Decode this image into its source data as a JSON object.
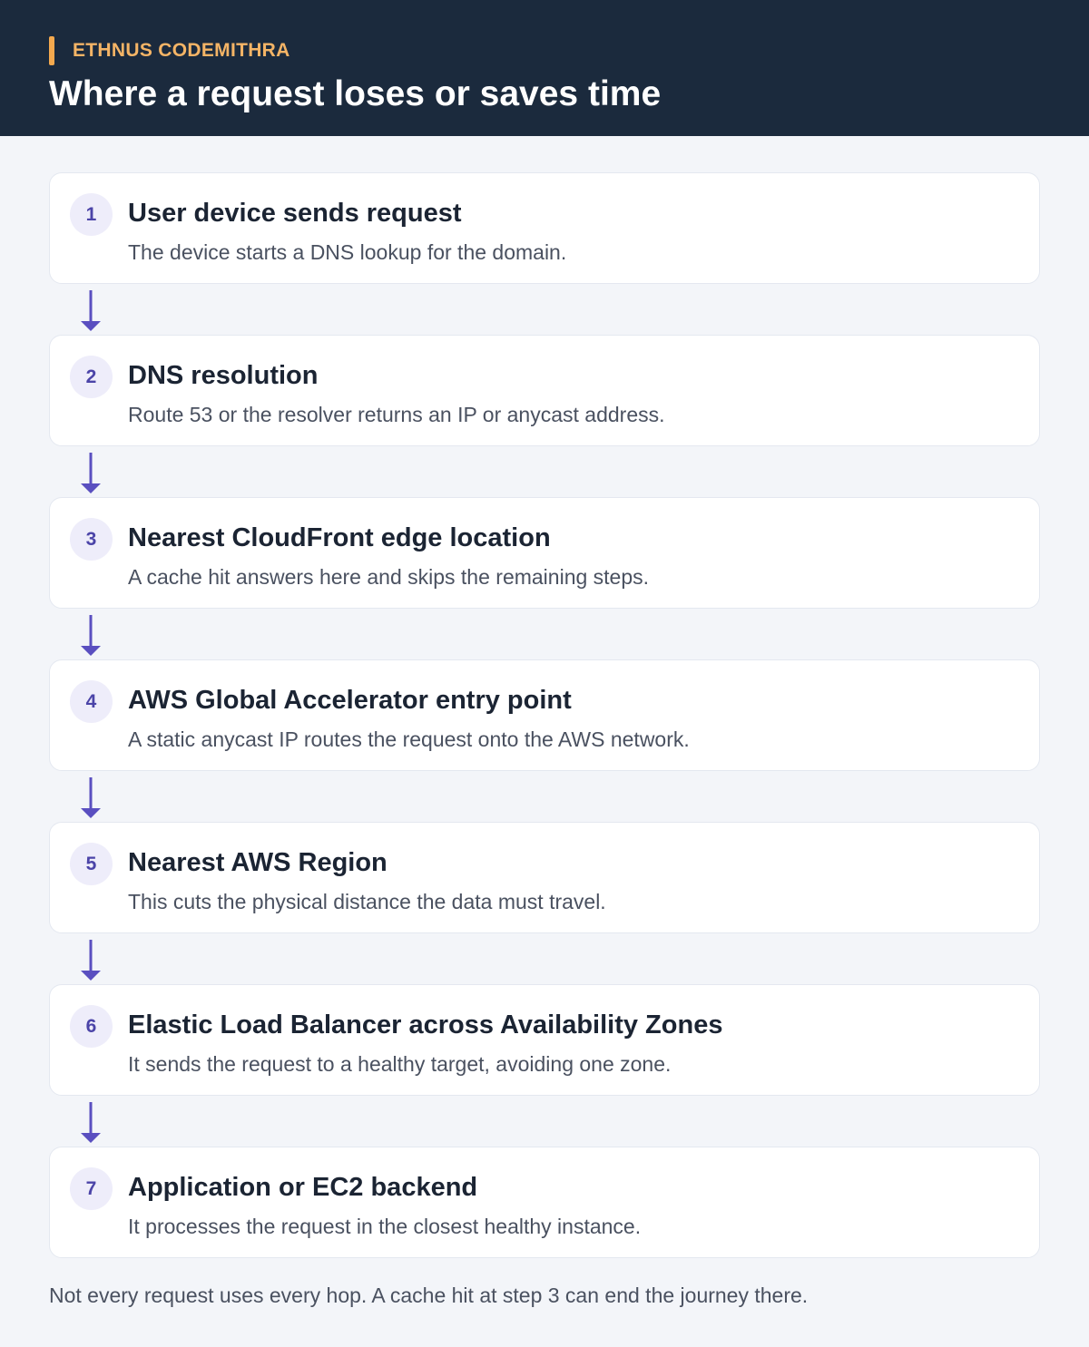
{
  "header": {
    "brand": "ETHNUS CODEMITHRA",
    "title": "Where a request loses or saves time"
  },
  "steps": [
    {
      "number": "1",
      "title": "User device sends request",
      "description": "The device starts a DNS lookup for the domain."
    },
    {
      "number": "2",
      "title": "DNS resolution",
      "description": "Route 53 or the resolver returns an IP or anycast address."
    },
    {
      "number": "3",
      "title": "Nearest CloudFront edge location",
      "description": "A cache hit answers here and skips the remaining steps."
    },
    {
      "number": "4",
      "title": "AWS Global Accelerator entry point",
      "description": "A static anycast IP routes the request onto the AWS network."
    },
    {
      "number": "5",
      "title": "Nearest AWS Region",
      "description": "This cuts the physical distance the data must travel."
    },
    {
      "number": "6",
      "title": "Elastic Load Balancer across Availability Zones",
      "description": "It sends the request to a healthy target, avoiding one zone."
    },
    {
      "number": "7",
      "title": "Application or EC2 backend",
      "description": "It processes the request in the closest healthy instance."
    }
  ],
  "footer": {
    "note": "Not every request uses every hop. A cache hit at step 3 can end the journey there."
  },
  "colors": {
    "header_bg": "#1b2a3d",
    "accent_orange": "#f4a94e",
    "arrow_purple": "#5a4fc0",
    "number_bg": "#eeedfa",
    "page_bg": "#f3f5f9"
  }
}
